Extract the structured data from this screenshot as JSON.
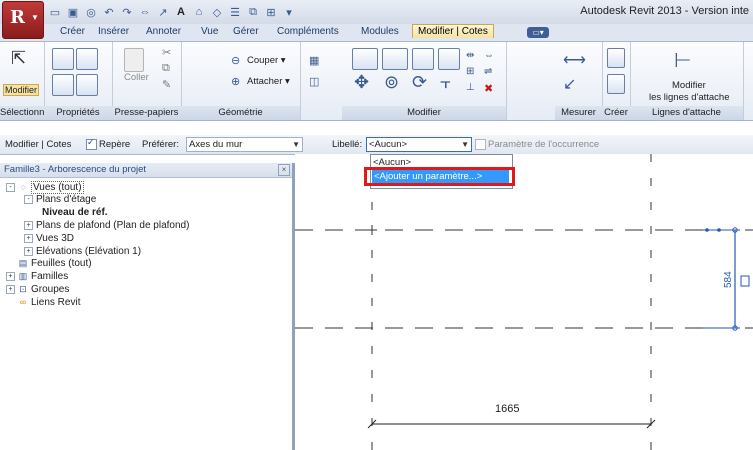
{
  "title_bar": {
    "app_title": "Autodesk Revit 2013 - Version inte"
  },
  "ribbon_tabs": [
    "Créer",
    "Insérer",
    "Annoter",
    "Vue",
    "Gérer",
    "Compléments",
    "Modules",
    "Modifier | Cotes"
  ],
  "ribbon": {
    "modify_label": "Modifier",
    "select_panel": "Sélectionner",
    "properties_panel": "Propriétés",
    "clipboard_panel": "Presse-papiers",
    "paste_label": "Coller",
    "geometry_panel": "Géométrie",
    "cut_label": "Couper",
    "join_label": "Attacher",
    "modify_panel": "Modifier",
    "measure_panel": "Mesurer",
    "create_panel": "Créer",
    "witness_panel": "Lignes d'attache",
    "witness_btn_line1": "Modifier",
    "witness_btn_line2": "les lignes d'attache"
  },
  "options_bar": {
    "context": "Modifier | Cotes",
    "repere_label": "Repère",
    "repere_checked": true,
    "prefer_label": "Préférer:",
    "prefer_value": "Axes du mur",
    "libelle_label": "Libellé:",
    "libelle_value": "<Aucun>",
    "instance_param_label": "Paramètre de l'occurrence"
  },
  "dropdown": {
    "items": [
      "<Aucun>",
      "<Ajouter un paramètre...>"
    ],
    "selected_index": 1
  },
  "project_browser": {
    "title": "Famille3 - Arborescence du projet",
    "tree": [
      {
        "label": "Vues (tout)",
        "level": 0,
        "toggle": "-",
        "icon": "views-icon"
      },
      {
        "label": "Plans d'étage",
        "level": 1,
        "toggle": "-",
        "icon": ""
      },
      {
        "label": "Niveau de réf.",
        "level": 2,
        "toggle": "",
        "icon": "",
        "bold": true
      },
      {
        "label": "Plans de plafond (Plan de plafond)",
        "level": 1,
        "toggle": "+",
        "icon": ""
      },
      {
        "label": "Vues 3D",
        "level": 1,
        "toggle": "+",
        "icon": ""
      },
      {
        "label": "Elévations (Elévation 1)",
        "level": 1,
        "toggle": "+",
        "icon": ""
      },
      {
        "label": "Feuilles (tout)",
        "level": 0,
        "toggle": "",
        "icon": "sheets-icon"
      },
      {
        "label": "Familles",
        "level": 0,
        "toggle": "+",
        "icon": "families-icon"
      },
      {
        "label": "Groupes",
        "level": 0,
        "toggle": "+",
        "icon": "groups-icon"
      },
      {
        "label": "Liens Revit",
        "level": 0,
        "toggle": "",
        "icon": "links-icon"
      }
    ]
  },
  "drawing": {
    "horizontal_dimension": "1665",
    "vertical_dimension": "584"
  }
}
